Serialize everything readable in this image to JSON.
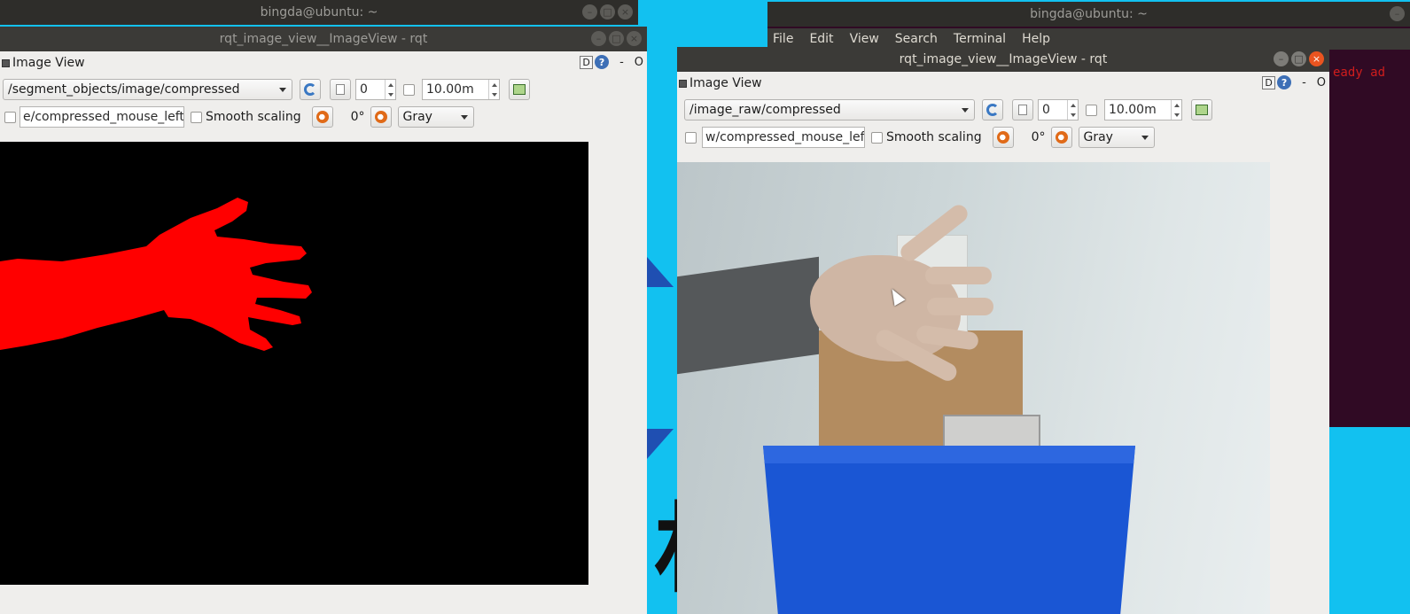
{
  "terminal": {
    "title": "bingda@ubuntu: ~",
    "menu": [
      "File",
      "Edit",
      "View",
      "Search",
      "Terminal",
      "Help"
    ],
    "visible_text": "eady ad"
  },
  "back_window": {
    "title": "bingda@ubuntu: ~"
  },
  "left_rqt": {
    "window_title": "rqt_image_view__ImageView - rqt",
    "dock_title": "Image View",
    "dock_d": "D",
    "dock_help": "?",
    "dock_minus": "-",
    "dock_o": "O",
    "topic": "/segment_objects/image/compressed",
    "spin_value": "0",
    "max_value": "10.00m",
    "mouse_topic": "e/compressed_mouse_left",
    "smooth_label": "Smooth scaling",
    "rotation": "0°",
    "color_scheme": "Gray"
  },
  "right_rqt": {
    "window_title": "rqt_image_view__ImageView - rqt",
    "dock_title": "Image View",
    "dock_d": "D",
    "dock_help": "?",
    "dock_minus": "-",
    "dock_o": "O",
    "topic": "/image_raw/compressed",
    "spin_value": "0",
    "max_value": "10.00m",
    "mouse_topic": "w/compressed_mouse_left",
    "smooth_label": "Smooth scaling",
    "rotation": "0°",
    "color_scheme": "Gray"
  },
  "desktop": {
    "glyph": "材"
  },
  "colors": {
    "desktop": "#12c1f0",
    "terminal_bg": "#300a24",
    "mask": "#ff0000",
    "close": "#e95420"
  }
}
